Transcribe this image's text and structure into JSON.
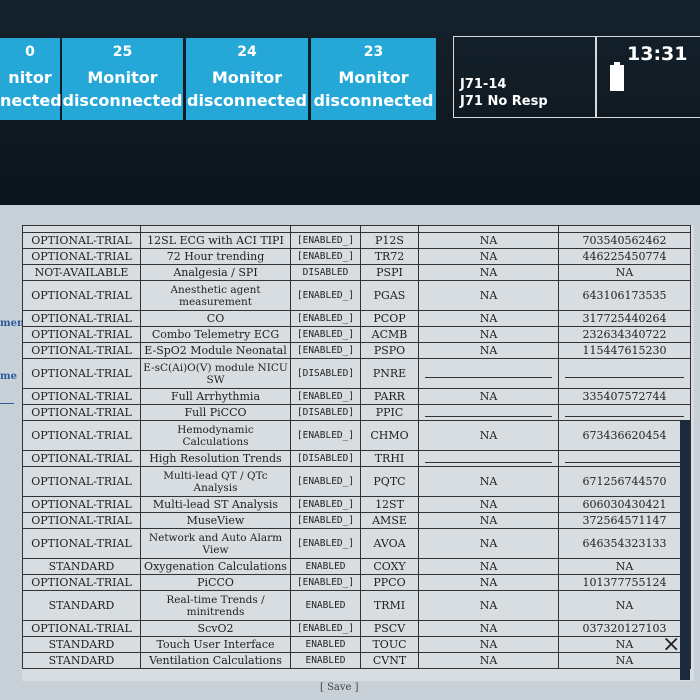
{
  "beds": [
    {
      "number": "0",
      "line1": "nitor",
      "line2": "nected"
    },
    {
      "number": "25",
      "line1": "Monitor",
      "line2": "disconnected"
    },
    {
      "number": "24",
      "line1": "Monitor",
      "line2": "disconnected"
    },
    {
      "number": "23",
      "line1": "Monitor",
      "line2": "disconnected"
    }
  ],
  "alarm": {
    "device": "J71-14",
    "message": "J71 No Resp"
  },
  "clock": {
    "time": "13:31"
  },
  "sidebar": {
    "label1": "ment",
    "label2": "me"
  },
  "rows": [
    {
      "status": "OPTIONAL-TRIAL",
      "feature": "12SL ECG with ACI TIPI",
      "state": "[ENABLED_]",
      "code": "P12S",
      "col5": "NA",
      "key": "703540562462"
    },
    {
      "status": "OPTIONAL-TRIAL",
      "feature": "72 Hour trending",
      "state": "[ENABLED_]",
      "code": "TR72",
      "col5": "NA",
      "key": "446225450774"
    },
    {
      "status": "NOT-AVAILABLE",
      "feature": "Analgesia / SPI",
      "state": "DISABLED",
      "code": "PSPI",
      "col5": "NA",
      "key": "NA"
    },
    {
      "status": "OPTIONAL-TRIAL",
      "feature": "Anesthetic agent measurement",
      "state": "[ENABLED_]",
      "code": "PGAS",
      "col5": "NA",
      "key": "643106173535"
    },
    {
      "status": "OPTIONAL-TRIAL",
      "feature": "CO",
      "state": "[ENABLED_]",
      "code": "PCOP",
      "col5": "NA",
      "key": "317725440264"
    },
    {
      "status": "OPTIONAL-TRIAL",
      "feature": "Combo Telemetry ECG",
      "state": "[ENABLED_]",
      "code": "ACMB",
      "col5": "NA",
      "key": "232634340722"
    },
    {
      "status": "OPTIONAL-TRIAL",
      "feature": "E-SpO2 Module Neonatal",
      "state": "[ENABLED_]",
      "code": "PSPO",
      "col5": "NA",
      "key": "115447615230"
    },
    {
      "status": "OPTIONAL-TRIAL",
      "feature": "E-sC(Ai)O(V) module NICU SW",
      "state": "[DISABLED]",
      "code": "PNRE",
      "col5": "",
      "key": ""
    },
    {
      "status": "OPTIONAL-TRIAL",
      "feature": "Full Arrhythmia",
      "state": "[ENABLED_]",
      "code": "PARR",
      "col5": "NA",
      "key": "335407572744"
    },
    {
      "status": "OPTIONAL-TRIAL",
      "feature": "Full PiCCO",
      "state": "[DISABLED]",
      "code": "PPIC",
      "col5": "",
      "key": ""
    },
    {
      "status": "OPTIONAL-TRIAL",
      "feature": "Hemodynamic Calculations",
      "state": "[ENABLED_]",
      "code": "CHMO",
      "col5": "NA",
      "key": "673436620454"
    },
    {
      "status": "OPTIONAL-TRIAL",
      "feature": "High Resolution Trends",
      "state": "[DISABLED]",
      "code": "TRHI",
      "col5": "",
      "key": ""
    },
    {
      "status": "OPTIONAL-TRIAL",
      "feature": "Multi-lead QT / QTc Analysis",
      "state": "[ENABLED_]",
      "code": "PQTC",
      "col5": "NA",
      "key": "671256744570"
    },
    {
      "status": "OPTIONAL-TRIAL",
      "feature": "Multi-lead ST Analysis",
      "state": "[ENABLED_]",
      "code": "12ST",
      "col5": "NA",
      "key": "606030430421"
    },
    {
      "status": "OPTIONAL-TRIAL",
      "feature": "MuseView",
      "state": "[ENABLED_]",
      "code": "AMSE",
      "col5": "NA",
      "key": "372564571147"
    },
    {
      "status": "OPTIONAL-TRIAL",
      "feature": "Network and Auto Alarm View",
      "state": "[ENABLED_]",
      "code": "AVOA",
      "col5": "NA",
      "key": "646354323133"
    },
    {
      "status": "STANDARD",
      "feature": "Oxygenation Calculations",
      "state": "ENABLED",
      "code": "COXY",
      "col5": "NA",
      "key": "NA"
    },
    {
      "status": "OPTIONAL-TRIAL",
      "feature": "PiCCO",
      "state": "[ENABLED_]",
      "code": "PPCO",
      "col5": "NA",
      "key": "101377755124"
    },
    {
      "status": "STANDARD",
      "feature": "Real-time Trends / minitrends",
      "state": "ENABLED",
      "code": "TRMI",
      "col5": "NA",
      "key": "NA"
    },
    {
      "status": "OPTIONAL-TRIAL",
      "feature": "ScvO2",
      "state": "[ENABLED_]",
      "code": "PSCV",
      "col5": "NA",
      "key": "037320127103"
    },
    {
      "status": "STANDARD",
      "feature": "Touch User Interface",
      "state": "ENABLED",
      "code": "TOUC",
      "col5": "NA",
      "key": "NA"
    },
    {
      "status": "STANDARD",
      "feature": "Ventilation Calculations",
      "state": "ENABLED",
      "code": "CVNT",
      "col5": "NA",
      "key": "NA"
    }
  ],
  "save_label": "[ Save ]"
}
